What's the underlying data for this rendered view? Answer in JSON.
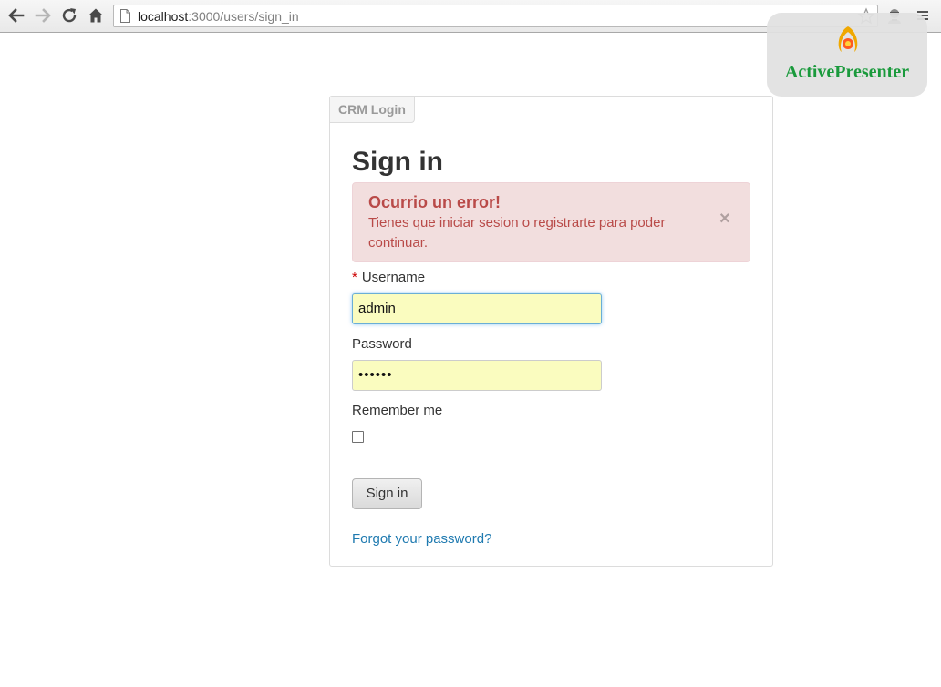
{
  "browser": {
    "url_host": "localhost",
    "url_path": ":3000/users/sign_in"
  },
  "watermark": {
    "text": "ActivePresenter"
  },
  "panel": {
    "tab_label": "CRM Login",
    "title": "Sign in",
    "alert": {
      "heading": "Ocurrio un error!",
      "message": "Tienes que iniciar sesion o registrarte para poder continuar.",
      "close": "×"
    },
    "username": {
      "required_mark": "*",
      "label": "Username",
      "value": "admin"
    },
    "password": {
      "label": "Password",
      "masked_value": "••••••"
    },
    "remember": {
      "label": "Remember me",
      "checked": false
    },
    "submit_label": "Sign in",
    "forgot_link": "Forgot your password?"
  },
  "colors": {
    "alert_text": "#b94a48",
    "alert_bg": "#f2dede",
    "autofill_bg": "#fafcbf",
    "link": "#1f7ab0",
    "watermark_text": "#1a9a3c"
  },
  "icons": {
    "back": "arrow-left-icon",
    "forward": "arrow-right-icon",
    "reload": "reload-icon",
    "home": "home-icon",
    "page": "page-icon",
    "bookmark": "star-icon",
    "extension": "extension-icon",
    "menu": "menu-icon",
    "logo": "activepresenter-logo-icon"
  }
}
